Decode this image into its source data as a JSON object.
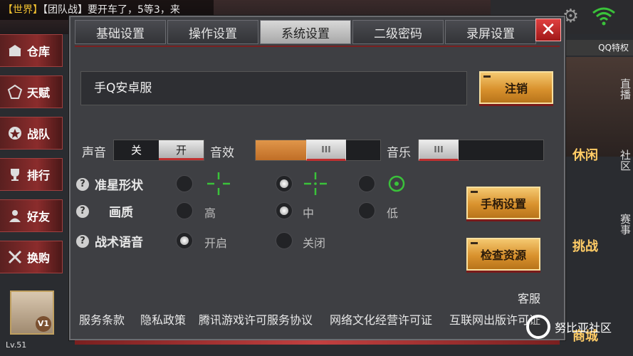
{
  "chat": {
    "channel": "【世界】",
    "message": "【团队战】要开车了，5等3，来"
  },
  "qq_badge": "QQ特权",
  "left_menu": [
    {
      "label": "仓库",
      "icon": "warehouse-icon"
    },
    {
      "label": "天赋",
      "icon": "talent-icon"
    },
    {
      "label": "战队",
      "icon": "clan-icon"
    },
    {
      "label": "排行",
      "icon": "ranking-icon"
    },
    {
      "label": "好友",
      "icon": "friends-icon"
    },
    {
      "label": "换购",
      "icon": "exchange-icon"
    }
  ],
  "player": {
    "vip": "V1",
    "level": "Lv.51"
  },
  "right_panel": {
    "side_items": [
      "直播",
      "社区",
      "赛事"
    ],
    "labels": [
      "休闲",
      "挑战",
      "商城"
    ]
  },
  "watermark": "努比亚社区",
  "dialog": {
    "tabs": [
      {
        "label": "基础设置",
        "active": false
      },
      {
        "label": "操作设置",
        "active": false
      },
      {
        "label": "系统设置",
        "active": true
      },
      {
        "label": "二级密码",
        "active": false
      },
      {
        "label": "录屏设置",
        "active": false
      }
    ],
    "close_label": "✕",
    "server_name": "手Q安卓服",
    "logout_label": "注销",
    "sound": {
      "label": "声音",
      "off": "关",
      "on": "开",
      "value": "开"
    },
    "sfx": {
      "label": "音效",
      "level": 0.6
    },
    "music": {
      "label": "音乐",
      "level": 0.0
    },
    "knob_glyph": "III",
    "crosshair_label": "准星形状",
    "quality_label": "画质",
    "quality_options": [
      "高",
      "中",
      "低"
    ],
    "quality_selected": "中",
    "voice_label": "战术语音",
    "voice_options": [
      "开启",
      "关闭"
    ],
    "voice_selected": "开启",
    "crosshair_selected": 1,
    "help_glyph": "?",
    "gamepad_label": "手柄设置",
    "check_label": "检查资源",
    "support_label": "客服",
    "links": [
      "服务条款",
      "隐私政策",
      "腾讯游戏许可服务协议",
      "网络文化经营许可证",
      "互联网出版许可证"
    ],
    "colors": {
      "accent_green": "#3ac23a",
      "gold": "#d9922e",
      "slider_fill": "#c97a34",
      "close_red": "#c02828"
    }
  }
}
